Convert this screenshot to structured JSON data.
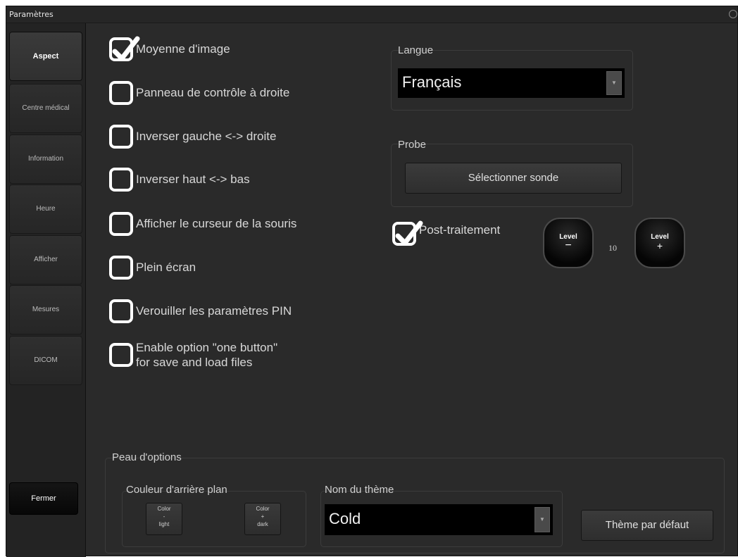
{
  "window": {
    "title": "Paramètres"
  },
  "sidebar": {
    "items": [
      {
        "label": "Aspect"
      },
      {
        "label": "Centre médical"
      },
      {
        "label": "Information"
      },
      {
        "label": "Heure"
      },
      {
        "label": "Afficher"
      },
      {
        "label": "Mesures"
      },
      {
        "label": "DICOM"
      }
    ],
    "close_label": "Fermer"
  },
  "options": [
    {
      "label": "Moyenne d'image",
      "checked": true
    },
    {
      "label": "Panneau de contrôle à droite",
      "checked": false
    },
    {
      "label": "Inverser gauche <-> droite",
      "checked": false
    },
    {
      "label": "Inverser haut  <-> bas",
      "checked": false
    },
    {
      "label": "Afficher le curseur de la souris",
      "checked": false
    },
    {
      "label": "Plein écran",
      "checked": false
    },
    {
      "label": "Verouiller les paramètres PIN",
      "checked": false
    },
    {
      "label_line1": "Enable option \"one button\"",
      "label_line2": "for save and load files",
      "checked": false
    }
  ],
  "langue": {
    "title": "Langue",
    "value": "Français"
  },
  "probe": {
    "title": "Probe",
    "button": "Sélectionner sonde"
  },
  "post": {
    "label": "Post-traitement",
    "checked": true,
    "minus": {
      "top": "Level",
      "sign": "−"
    },
    "plus": {
      "top": "Level",
      "sign": "+"
    },
    "level_value": "10"
  },
  "skin": {
    "title": "Peau d'options",
    "bg": {
      "title": "Couleur d'arrière plan",
      "light": {
        "l1": "Color",
        "l2": "-",
        "l3": "light"
      },
      "dark": {
        "l1": "Color",
        "l2": "+",
        "l3": "dark"
      }
    },
    "theme": {
      "title": "Nom du thème",
      "value": "Cold"
    },
    "default_button": "Thème par défaut"
  }
}
